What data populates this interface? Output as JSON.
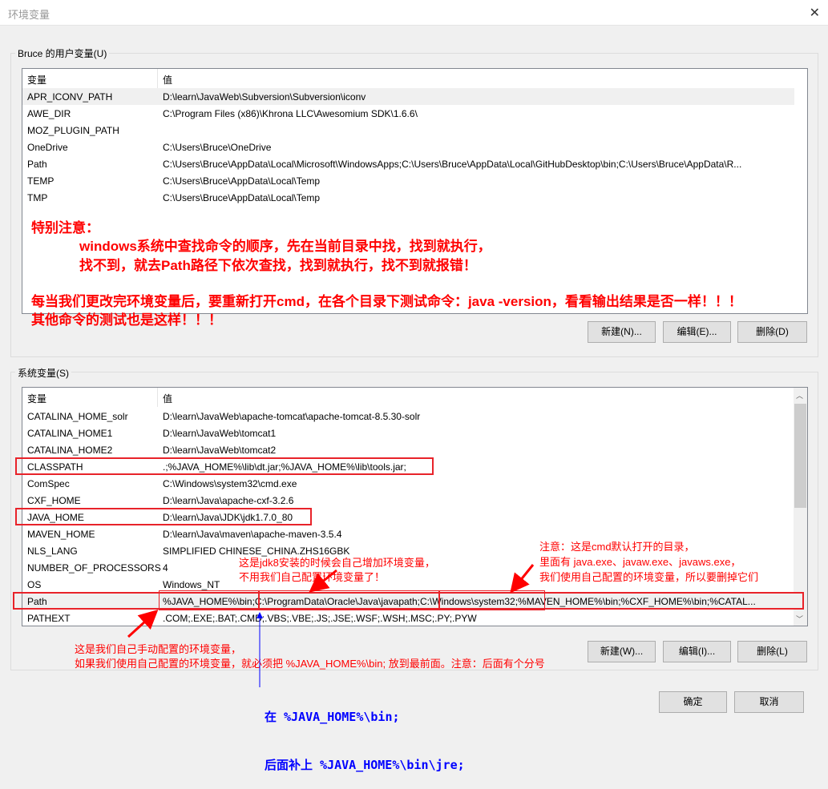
{
  "window": {
    "title": "环境变量",
    "close": "✕"
  },
  "user": {
    "group_label": "Bruce 的用户变量(U)",
    "col_name": "变量",
    "col_value": "值",
    "rows": [
      {
        "name": "APR_ICONV_PATH",
        "value": "D:\\learn\\JavaWeb\\Subversion\\Subversion\\iconv"
      },
      {
        "name": "AWE_DIR",
        "value": "C:\\Program Files (x86)\\Khrona LLC\\Awesomium SDK\\1.6.6\\"
      },
      {
        "name": "MOZ_PLUGIN_PATH",
        "value": ""
      },
      {
        "name": "OneDrive",
        "value": "C:\\Users\\Bruce\\OneDrive"
      },
      {
        "name": "Path",
        "value": "C:\\Users\\Bruce\\AppData\\Local\\Microsoft\\WindowsApps;C:\\Users\\Bruce\\AppData\\Local\\GitHubDesktop\\bin;C:\\Users\\Bruce\\AppData\\R..."
      },
      {
        "name": "TEMP",
        "value": "C:\\Users\\Bruce\\AppData\\Local\\Temp"
      },
      {
        "name": "TMP",
        "value": "C:\\Users\\Bruce\\AppData\\Local\\Temp"
      }
    ],
    "new": "新建(N)...",
    "edit": "编辑(E)...",
    "delete": "删除(D)"
  },
  "system": {
    "group_label": "系统变量(S)",
    "col_name": "变量",
    "col_value": "值",
    "rows": [
      {
        "name": "CATALINA_HOME_solr",
        "value": "D:\\learn\\JavaWeb\\apache-tomcat\\apache-tomcat-8.5.30-solr"
      },
      {
        "name": "CATALINA_HOME1",
        "value": "D:\\learn\\JavaWeb\\tomcat1"
      },
      {
        "name": "CATALINA_HOME2",
        "value": "D:\\learn\\JavaWeb\\tomcat2"
      },
      {
        "name": "CLASSPATH",
        "value": ".;%JAVA_HOME%\\lib\\dt.jar;%JAVA_HOME%\\lib\\tools.jar;"
      },
      {
        "name": "ComSpec",
        "value": "C:\\Windows\\system32\\cmd.exe"
      },
      {
        "name": "CXF_HOME",
        "value": "D:\\learn\\Java\\apache-cxf-3.2.6"
      },
      {
        "name": "JAVA_HOME",
        "value": "D:\\learn\\Java\\JDK\\jdk1.7.0_80"
      },
      {
        "name": "MAVEN_HOME",
        "value": "D:\\learn\\Java\\maven\\apache-maven-3.5.4"
      },
      {
        "name": "NLS_LANG",
        "value": "SIMPLIFIED CHINESE_CHINA.ZHS16GBK"
      },
      {
        "name": "NUMBER_OF_PROCESSORS",
        "value": "4"
      },
      {
        "name": "OS",
        "value": "Windows_NT"
      },
      {
        "name": "Path",
        "value": "%JAVA_HOME%\\bin;C:\\ProgramData\\Oracle\\Java\\javapath;C:\\Windows\\system32;%MAVEN_HOME%\\bin;%CXF_HOME%\\bin;%CATAL..."
      },
      {
        "name": "PATHEXT",
        "value": ".COM;.EXE;.BAT;.CMD;.VBS;.VBE;.JS;.JSE;.WSF;.WSH;.MSC;.PY;.PYW"
      }
    ],
    "new": "新建(W)...",
    "edit": "编辑(I)...",
    "delete": "删除(L)"
  },
  "ok": "确定",
  "cancel": "取消",
  "annotations": {
    "big": [
      "特别注意：",
      "windows系统中查找命令的顺序，先在当前目录中找，找到就执行，",
      "找不到，就去Path路径下依次查找，找到就执行，找不到就报错！",
      "每当我们更改完环境变量后，要重新打开cmd，在各个目录下测试命令：java -version，看看输出结果是否一样！！！",
      "其他命令的测试也是这样！！！"
    ],
    "jdk8": [
      "这是jdk8安装的时候会自己增加环境变量，",
      "不用我们自己配置环境变量了！"
    ],
    "cmd": [
      "注意：这是cmd默认打开的目录，",
      "里面有 java.exe、javaw.exe、javaws.exe，",
      "我们使用自己配置的环境变量，所以要删掉它们"
    ],
    "manual": [
      "这是我们自己手动配置的环境变量，",
      "如果我们使用自己配置的环境变量，就必须把 %JAVA_HOME%\\bin; 放到最前面。注意：后面有个分号"
    ],
    "jre": [
      "在 %JAVA_HOME%\\bin;",
      "后面补上 %JAVA_HOME%\\bin\\jre;"
    ]
  },
  "colors": {
    "annotation_red": "#ff0000",
    "annotation_blue": "#0000ff",
    "highlight_box": "#e8232a"
  }
}
